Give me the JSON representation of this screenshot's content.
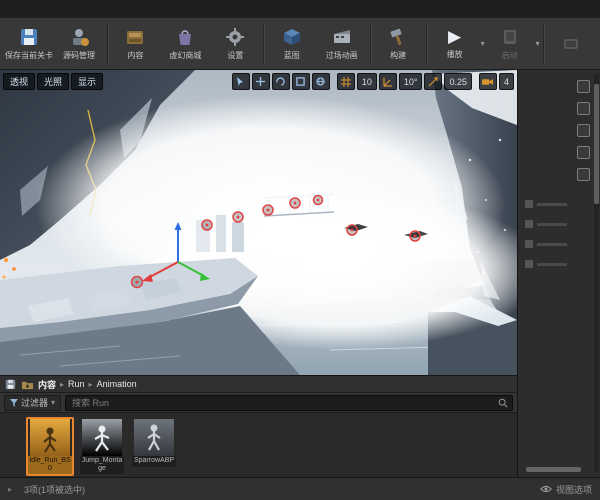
{
  "glyphs": {
    "caret_down": "▾",
    "chevron": "▸",
    "play": "▶"
  },
  "toolbar": {
    "buttons": [
      {
        "label": "保存当前关卡"
      },
      {
        "label": "源码管理"
      },
      {
        "label": "内容"
      },
      {
        "label": "虚幻商城"
      },
      {
        "label": "设置"
      },
      {
        "label": "蓝图"
      },
      {
        "label": "过场动画"
      },
      {
        "label": "构建"
      },
      {
        "label": "播放"
      },
      {
        "label": "启动"
      }
    ]
  },
  "viewport": {
    "perspective_label": "透视",
    "lit_label": "光照",
    "show_label": "显示",
    "snap": {
      "grid_value": "10",
      "angle_value": "10°",
      "scale_value": "0.25",
      "camera_speed": "4"
    }
  },
  "content_browser": {
    "breadcrumb": {
      "root": "内容",
      "level1": "Run",
      "level2": "Animation"
    },
    "filter_label": "过滤器",
    "search_placeholder": "搜索 Run",
    "assets": [
      {
        "name": "Idle_Run_BS0"
      },
      {
        "name": "Jump_Montage"
      },
      {
        "name": "SparrowABP"
      }
    ],
    "status_text": "3项(1项被选中)",
    "view_options_label": "视图选项"
  }
}
